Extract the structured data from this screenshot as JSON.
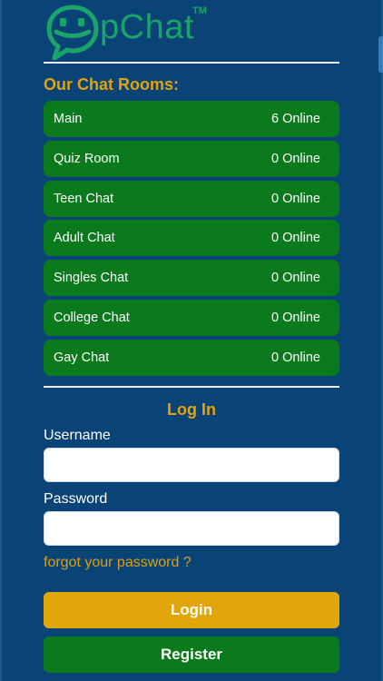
{
  "brand": {
    "name": "pChat",
    "trademark": "TM"
  },
  "rooms_section": {
    "title": "Our Chat Rooms:",
    "rooms": [
      {
        "name": "Main",
        "online": "6 Online"
      },
      {
        "name": "Quiz Room",
        "online": "0 Online"
      },
      {
        "name": "Teen Chat",
        "online": "0 Online"
      },
      {
        "name": "Adult Chat",
        "online": "0 Online"
      },
      {
        "name": "Singles Chat",
        "online": "0 Online"
      },
      {
        "name": "College Chat",
        "online": "0 Online"
      },
      {
        "name": "Gay Chat",
        "online": "0 Online"
      }
    ]
  },
  "login": {
    "title": "Log In",
    "username_label": "Username",
    "username_value": "",
    "password_label": "Password",
    "password_value": "",
    "forgot_link": "forgot your password ?",
    "login_button": "Login",
    "register_button": "Register"
  },
  "colors": {
    "background": "#0a4476",
    "accent_gold": "#e1a20b",
    "room_green": "#0b7a1c",
    "logo_green": "#1aa36a"
  },
  "icons": {
    "logo": "smiley-speech-bubble-icon"
  }
}
